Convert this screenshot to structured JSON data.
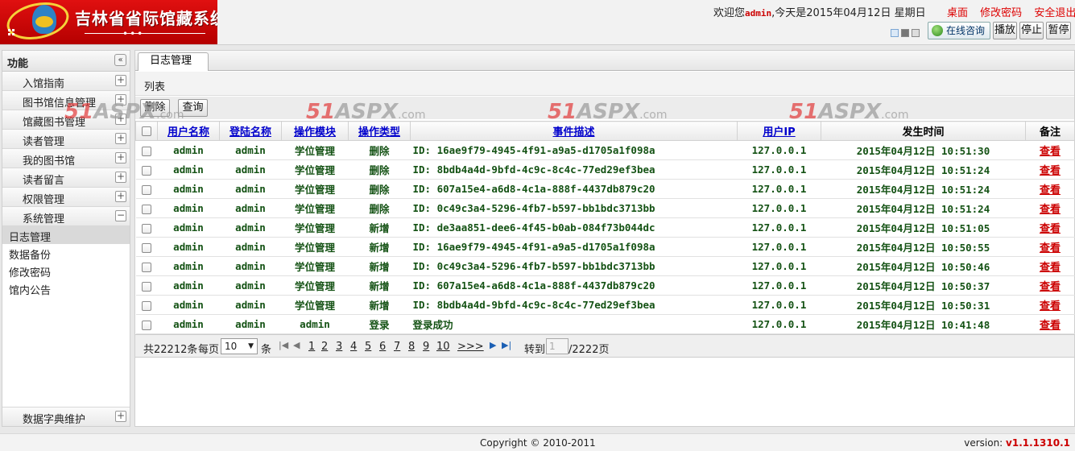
{
  "header": {
    "system_title": "吉林省省际馆藏系统",
    "welcome_prefix": "欢迎您",
    "username": "admin",
    "date_text": ",今天是2015年04月12日 星期日",
    "links": [
      "桌面",
      "修改密码",
      "安全退出"
    ],
    "online_label": "在线咨询",
    "controls": [
      "播放",
      "停止",
      "暂停"
    ]
  },
  "sidebar": {
    "title": "功能",
    "collapse_symbol": "«",
    "items": [
      {
        "label": "入馆指南",
        "toggle": "+"
      },
      {
        "label": "图书馆信息管理",
        "toggle": "+"
      },
      {
        "label": "馆藏图书管理",
        "toggle": "+"
      },
      {
        "label": "读者管理",
        "toggle": "+"
      },
      {
        "label": "我的图书馆",
        "toggle": "+"
      },
      {
        "label": "读者留言",
        "toggle": "+"
      },
      {
        "label": "权限管理",
        "toggle": "+"
      },
      {
        "label": "系统管理",
        "toggle": "−"
      }
    ],
    "subitems": [
      "日志管理",
      "数据备份",
      "修改密码",
      "馆内公告"
    ],
    "bottom_item": {
      "label": "数据字典维护",
      "toggle": "+"
    }
  },
  "main": {
    "tab": "日志管理",
    "list_label": "列表",
    "toolbar": {
      "delete": "删除",
      "query": "查询"
    },
    "watermark": {
      "num": "51",
      "asp": "ASPX",
      "dot": ".com"
    },
    "columns": [
      "用户名称",
      "登陆名称",
      "操作模块",
      "操作类型",
      "事件描述",
      "用户IP",
      "发生时间",
      "备注"
    ],
    "rows": [
      {
        "user": "admin",
        "login": "admin",
        "module": "学位管理",
        "type": "删除",
        "desc": "ID: 16ae9f79-4945-4f91-a9a5-d1705a1f098a",
        "ip": "127.0.0.1",
        "time": "2015年04月12日  10:51:30",
        "note": "查看"
      },
      {
        "user": "admin",
        "login": "admin",
        "module": "学位管理",
        "type": "删除",
        "desc": "ID: 8bdb4a4d-9bfd-4c9c-8c4c-77ed29ef3bea",
        "ip": "127.0.0.1",
        "time": "2015年04月12日  10:51:24",
        "note": "查看"
      },
      {
        "user": "admin",
        "login": "admin",
        "module": "学位管理",
        "type": "删除",
        "desc": "ID: 607a15e4-a6d8-4c1a-888f-4437db879c20",
        "ip": "127.0.0.1",
        "time": "2015年04月12日  10:51:24",
        "note": "查看"
      },
      {
        "user": "admin",
        "login": "admin",
        "module": "学位管理",
        "type": "删除",
        "desc": "ID: 0c49c3a4-5296-4fb7-b597-bb1bdc3713bb",
        "ip": "127.0.0.1",
        "time": "2015年04月12日  10:51:24",
        "note": "查看"
      },
      {
        "user": "admin",
        "login": "admin",
        "module": "学位管理",
        "type": "新增",
        "desc": "ID: de3aa851-dee6-4f45-b0ab-084f73b044dc",
        "ip": "127.0.0.1",
        "time": "2015年04月12日  10:51:05",
        "note": "查看"
      },
      {
        "user": "admin",
        "login": "admin",
        "module": "学位管理",
        "type": "新增",
        "desc": "ID: 16ae9f79-4945-4f91-a9a5-d1705a1f098a",
        "ip": "127.0.0.1",
        "time": "2015年04月12日  10:50:55",
        "note": "查看"
      },
      {
        "user": "admin",
        "login": "admin",
        "module": "学位管理",
        "type": "新增",
        "desc": "ID: 0c49c3a4-5296-4fb7-b597-bb1bdc3713bb",
        "ip": "127.0.0.1",
        "time": "2015年04月12日  10:50:46",
        "note": "查看"
      },
      {
        "user": "admin",
        "login": "admin",
        "module": "学位管理",
        "type": "新增",
        "desc": "ID: 607a15e4-a6d8-4c1a-888f-4437db879c20",
        "ip": "127.0.0.1",
        "time": "2015年04月12日  10:50:37",
        "note": "查看"
      },
      {
        "user": "admin",
        "login": "admin",
        "module": "学位管理",
        "type": "新增",
        "desc": "ID: 8bdb4a4d-9bfd-4c9c-8c4c-77ed29ef3bea",
        "ip": "127.0.0.1",
        "time": "2015年04月12日  10:50:31",
        "note": "查看"
      },
      {
        "user": "admin",
        "login": "admin",
        "module": "admin",
        "type": "登录",
        "desc": "登录成功",
        "ip": "127.0.0.1",
        "time": "2015年04月12日  10:41:48",
        "note": "查看"
      }
    ],
    "pager": {
      "total_text": "共22212条",
      "per_page_label": "每页",
      "per_page_value": "10",
      "unit": "条",
      "pages": [
        "1",
        "2",
        "3",
        "4",
        "5",
        "6",
        "7",
        "8",
        "9",
        "10",
        ">>>"
      ],
      "goto_label": "转到",
      "goto_placeholder": "1",
      "total_pages": "/2222页"
    }
  },
  "footer": {
    "copyright": "Copyright © 2010-2011",
    "version_label": "version: ",
    "version": "v1.1.1310.1"
  },
  "colors": {
    "brand_red": "#c00000",
    "row_text_green": "#145214",
    "link_blue": "#0000cc"
  }
}
